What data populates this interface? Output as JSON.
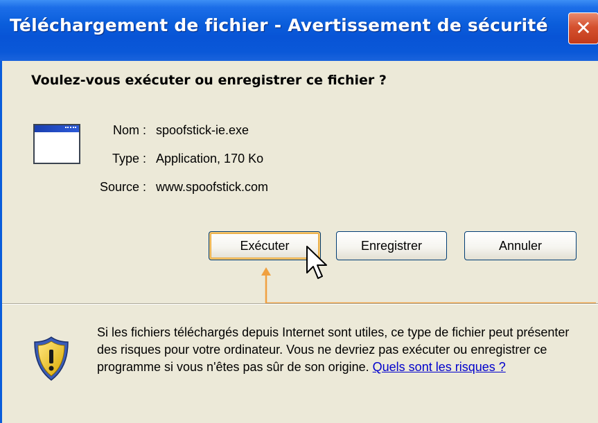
{
  "window": {
    "title": "Téléchargement de fichier - Avertissement de sécurité",
    "close_symbol": "✕"
  },
  "dialog": {
    "question": "Voulez-vous exécuter ou enregistrer ce fichier ?",
    "file_icon": "application-window-icon",
    "info": {
      "name_label": "Nom :",
      "name_value": "spoofstick-ie.exe",
      "type_label": "Type :",
      "type_value": "Application, 170 Ko",
      "source_label": "Source :",
      "source_value": "www.spoofstick.com"
    },
    "buttons": {
      "run": "Exécuter",
      "save": "Enregistrer",
      "cancel": "Annuler"
    },
    "warning_icon": "security-shield-warning-icon",
    "warning_text": "Si les fichiers téléchargés depuis Internet sont utiles, ce type de fichier peut présenter des risques pour votre ordinateur. Vous ne devriez pas exécuter ou enregistrer ce programme si vous n'êtes pas sûr de son origine.",
    "risk_link": "Quels sont les risques ?"
  },
  "colors": {
    "titlebar_blue": "#0a5ddb",
    "close_red": "#d5512f",
    "annotation_orange": "#f0a040",
    "link_blue": "#0000cc"
  }
}
